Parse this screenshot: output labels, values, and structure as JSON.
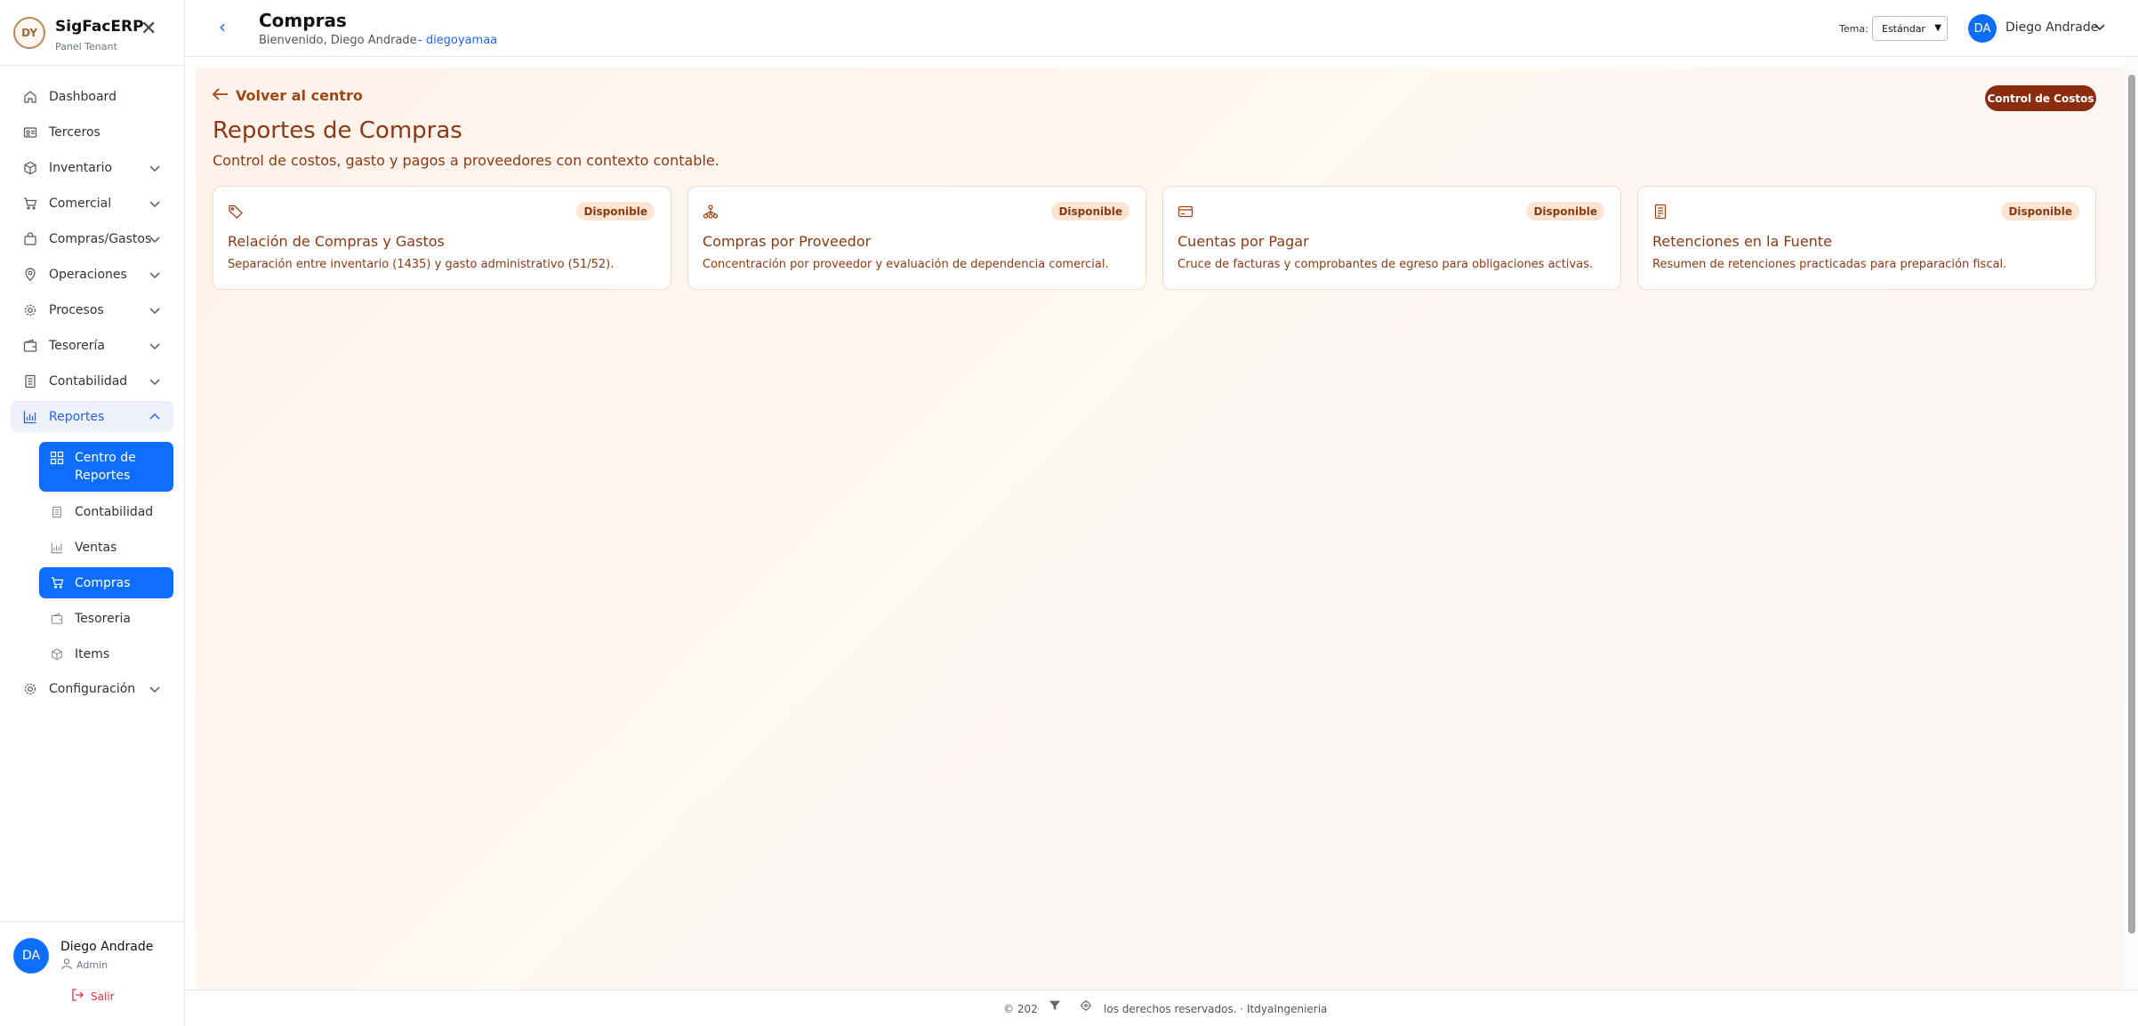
{
  "brand": {
    "logo_text": "DY",
    "name": "SigFacERP",
    "subtitle": "Panel Tenant",
    "close_symbol": "✕"
  },
  "nav": [
    {
      "label": "Dashboard",
      "icon": "home-icon",
      "expandable": false
    },
    {
      "label": "Terceros",
      "icon": "id-card-icon",
      "expandable": false
    },
    {
      "label": "Inventario",
      "icon": "box-icon",
      "expandable": true
    },
    {
      "label": "Comercial",
      "icon": "cart-icon",
      "expandable": true
    },
    {
      "label": "Compras/Gastos",
      "icon": "bag-icon",
      "expandable": true
    },
    {
      "label": "Operaciones",
      "icon": "map-pin-icon",
      "expandable": true
    },
    {
      "label": "Procesos",
      "icon": "gear-icon",
      "expandable": true
    },
    {
      "label": "Tesorería",
      "icon": "wallet-icon",
      "expandable": true
    },
    {
      "label": "Contabilidad",
      "icon": "ledger-icon",
      "expandable": true
    },
    {
      "label": "Reportes",
      "icon": "bar-chart-icon",
      "expandable": true,
      "expanded": true
    },
    {
      "label": "Configuración",
      "icon": "gear-icon",
      "expandable": true
    }
  ],
  "subnav": [
    {
      "label": "Centro de Reportes",
      "icon": "grid-icon",
      "active": true
    },
    {
      "label": "Contabilidad",
      "icon": "ledger-icon",
      "active": false
    },
    {
      "label": "Ventas",
      "icon": "bar-chart-icon",
      "active": false
    },
    {
      "label": "Compras",
      "icon": "cart-icon",
      "active": true
    },
    {
      "label": "Tesoreria",
      "icon": "wallet-icon",
      "active": false
    },
    {
      "label": "Items",
      "icon": "box-icon",
      "active": false
    }
  ],
  "user": {
    "initials": "DA",
    "name": "Diego Andrade",
    "role": "Admin",
    "logout": "Salir"
  },
  "topbar": {
    "back_symbol": "‹",
    "title": "Compras",
    "welcome": "Bienvenido, Diego Andrade",
    "handle": "- diegoyamaa",
    "theme_label": "Tema:",
    "theme_value": "Estándar",
    "user_initials": "DA",
    "user_name": "Diego Andrade"
  },
  "main": {
    "back_link": "Volver al centro",
    "action_button": "Control de Costos",
    "title": "Reportes de Compras",
    "subtitle": "Control de costos, gasto y pagos a proveedores con contexto contable.",
    "cards": [
      {
        "icon": "tag-icon",
        "badge": "Disponible",
        "title": "Relación de Compras y Gastos",
        "description": "Separación entre inventario (1435) y gasto administrativo (51/52)."
      },
      {
        "icon": "hierarchy-icon",
        "badge": "Disponible",
        "title": "Compras por Proveedor",
        "description": "Concentración por proveedor y evaluación de dependencia comercial."
      },
      {
        "icon": "credit-card-icon",
        "badge": "Disponible",
        "title": "Cuentas por Pagar",
        "description": "Cruce de facturas y comprobantes de egreso para obligaciones activas."
      },
      {
        "icon": "receipt-icon",
        "badge": "Disponible",
        "title": "Retenciones en la Fuente",
        "description": "Resumen de retenciones practicadas para preparación fiscal."
      }
    ]
  },
  "footer": {
    "text": "© 2026         odos los derechos reservados. · ItdyaIngenieria"
  },
  "colors": {
    "accent": "#0d6efd",
    "brown": "#8a3a14",
    "button": "#8a2d0e",
    "badge_bg": "#fde5d2"
  }
}
